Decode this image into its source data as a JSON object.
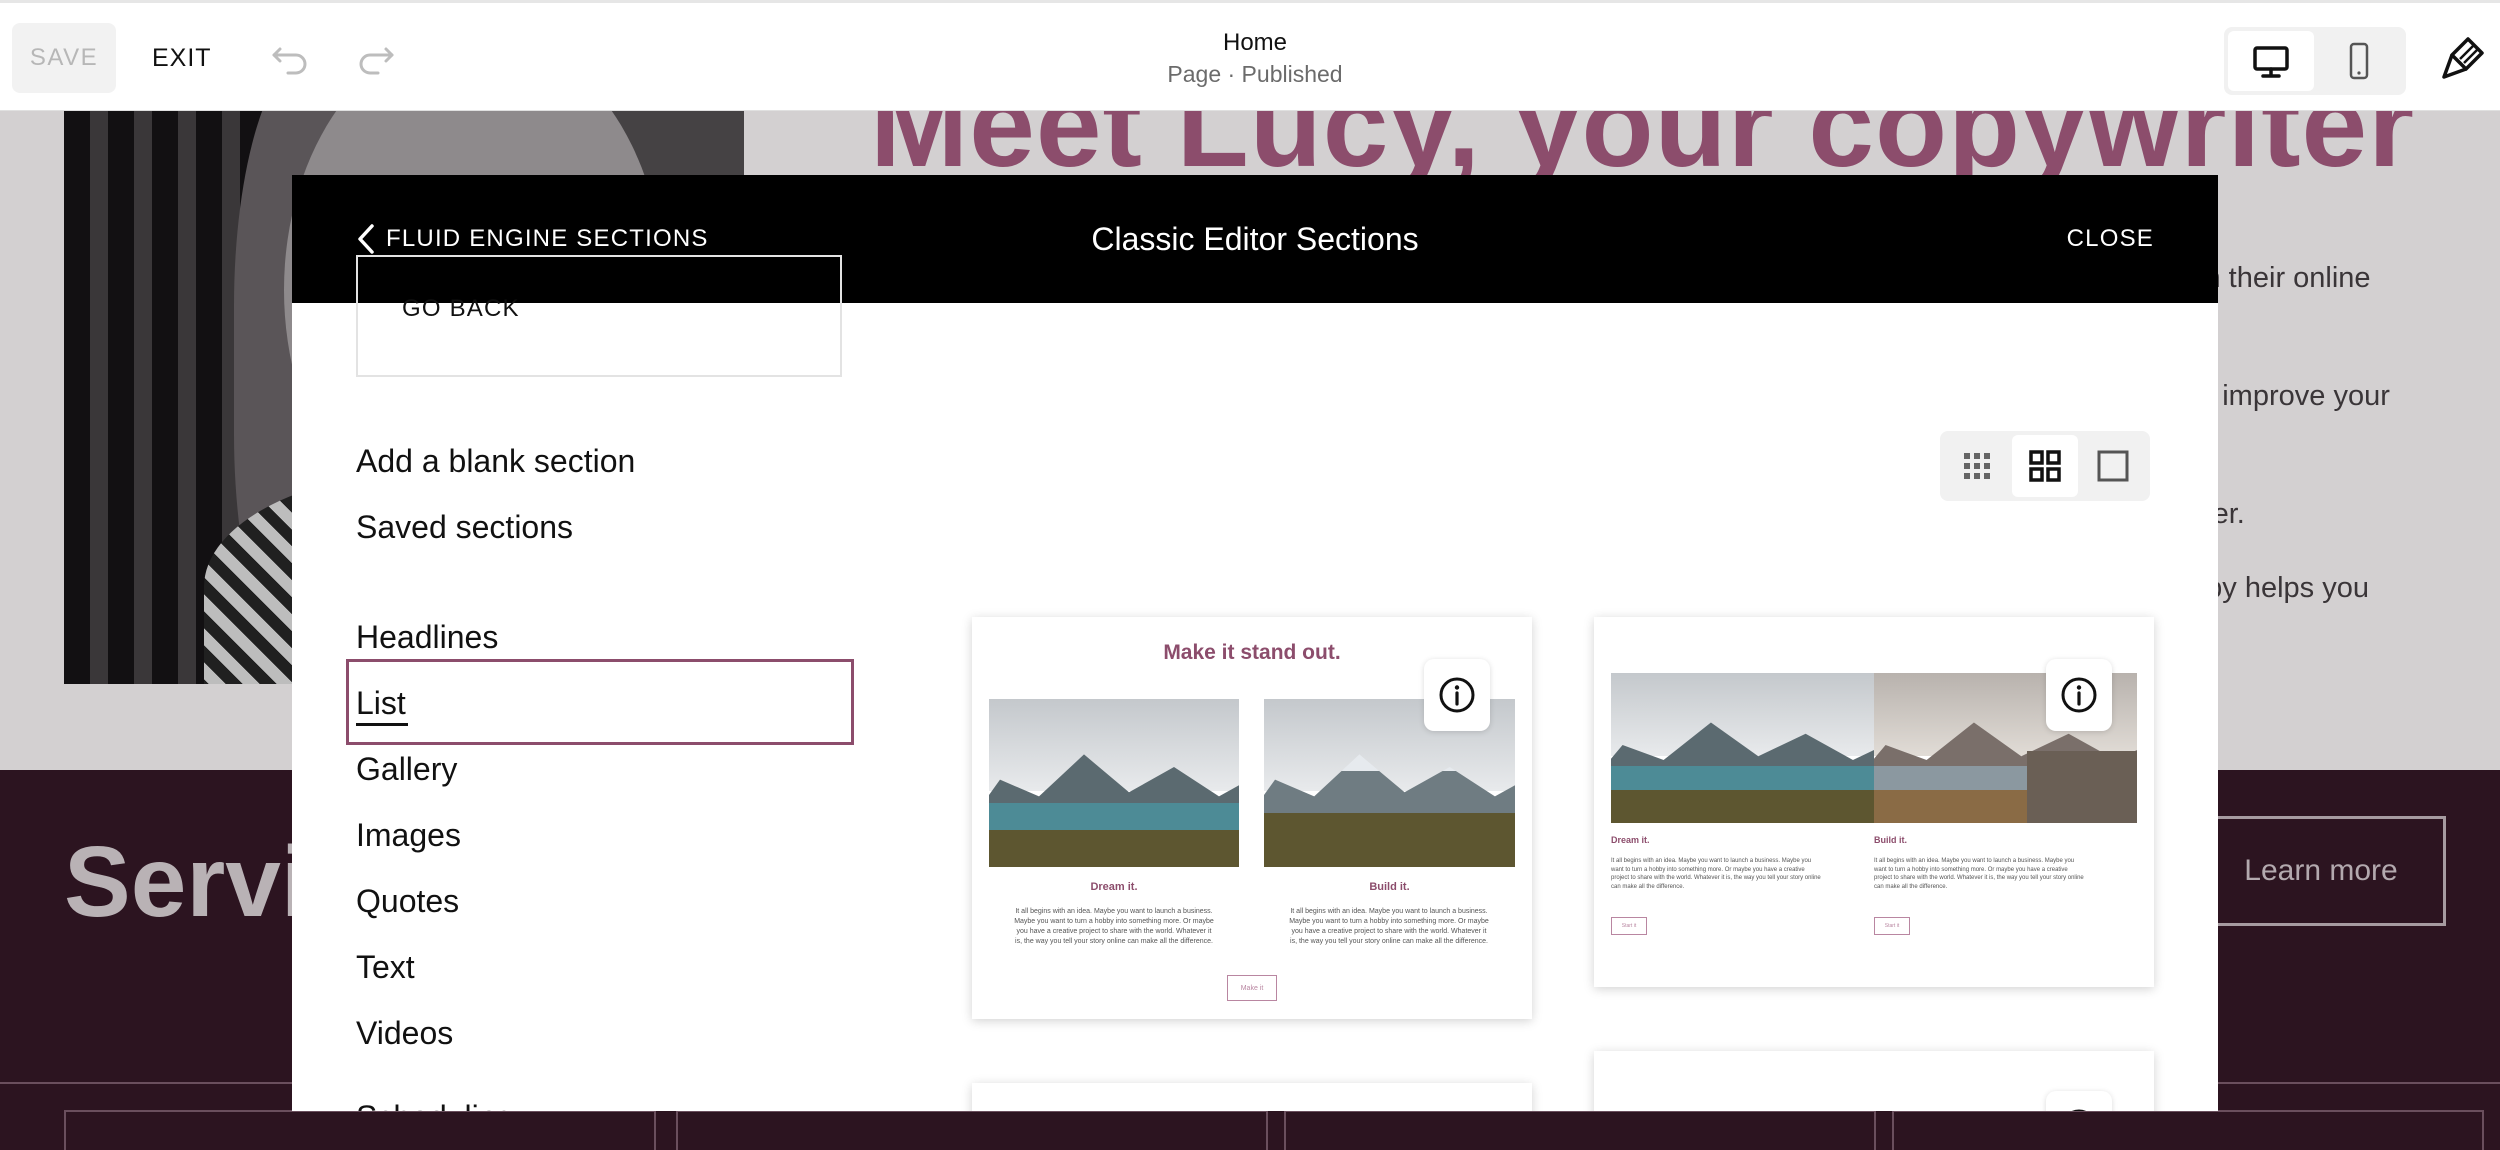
{
  "toolbar": {
    "save_label": "SAVE",
    "exit_label": "EXIT",
    "page_title": "Home",
    "page_status": "Page · Published",
    "icons": {
      "undo": "undo-icon",
      "redo": "redo-icon",
      "desktop": "desktop-icon",
      "mobile": "mobile-icon",
      "site_styles": "paintbrush-icon"
    }
  },
  "background": {
    "headline": "Meet Lucy, your copywriter",
    "lines": [
      "ch their online",
      "to improve your",
      "lder.",
      "opy helps you"
    ],
    "services_heading": "Servi",
    "learn_more_label": "Learn more"
  },
  "modal": {
    "back_label": "FLUID ENGINE SECTIONS",
    "title": "Classic Editor Sections",
    "close_label": "CLOSE",
    "go_back_label": "GO BACK",
    "add_blank_label": "Add a blank section",
    "saved_label": "Saved sections",
    "categories": [
      "Headlines",
      "List",
      "Gallery",
      "Images",
      "Quotes",
      "Text",
      "Videos",
      "Scheduling"
    ],
    "selected_category": "List",
    "view_modes": [
      "small-grid",
      "large-grid",
      "single"
    ],
    "active_view": "large-grid"
  },
  "thumbnails": [
    {
      "heading": "Make it stand out.",
      "columns": [
        {
          "title": "Dream it.",
          "body": "It all begins with an idea. Maybe you want to launch a business. Maybe you want to turn a hobby into something more. Or maybe you have a creative project to share with the world. Whatever it is, the way you tell your story online can make all the difference."
        },
        {
          "title": "Build it.",
          "body": "It all begins with an idea. Maybe you want to launch a business. Maybe you want to turn a hobby into something more. Or maybe you have a creative project to share with the world. Whatever it is, the way you tell your story online can make all the difference."
        }
      ],
      "button_label": "Make it"
    },
    {
      "columns": [
        {
          "title": "Dream it.",
          "body": "It all begins with an idea. Maybe you want to launch a business. Maybe you want to turn a hobby into something more. Or maybe you have a creative project to share with the world. Whatever it is, the way you tell your story online can make all the difference.",
          "button_label": "Start it"
        },
        {
          "title": "Build it.",
          "body": "It all begins with an idea. Maybe you want to launch a business. Maybe you want to turn a hobby into something more. Or maybe you have a creative project to share with the world. Whatever it is, the way you tell your story online can make all the difference.",
          "button_label": "Start it"
        }
      ]
    }
  ],
  "colors": {
    "accent": "#8c4d6c",
    "modal_header": "#000000",
    "dark_section": "#2c1420"
  }
}
